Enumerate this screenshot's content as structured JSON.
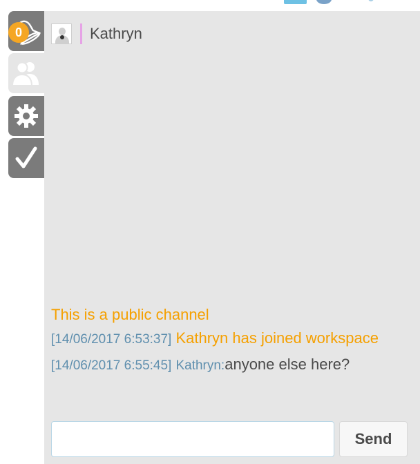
{
  "sidebar": {
    "notifications": {
      "icon": "bell-icon",
      "badge": "0"
    },
    "tabs": [
      {
        "id": "users",
        "icon": "users-icon"
      },
      {
        "id": "settings",
        "icon": "gear-icon"
      },
      {
        "id": "tasks",
        "icon": "check-icon"
      }
    ]
  },
  "header": {
    "user": {
      "name": "Kathryn",
      "presence_color": "#e6a3e6"
    }
  },
  "chat": {
    "channel_notice": "This is a public channel",
    "messages": [
      {
        "timestamp": "[14/06/2017 6:53:37]",
        "text": "Kathryn has joined workspace",
        "type": "system"
      },
      {
        "timestamp": "[14/06/2017 6:55:45]",
        "author": "Kathryn:",
        "text": "anyone else here?",
        "type": "message"
      }
    ]
  },
  "composer": {
    "value": "",
    "placeholder": "",
    "send_label": "Send"
  },
  "colors": {
    "accent_orange": "#f5a000",
    "timestamp_blue": "#5f8fae",
    "tab_gray": "#7b7b7b",
    "panel_bg": "#e6e6e6"
  }
}
